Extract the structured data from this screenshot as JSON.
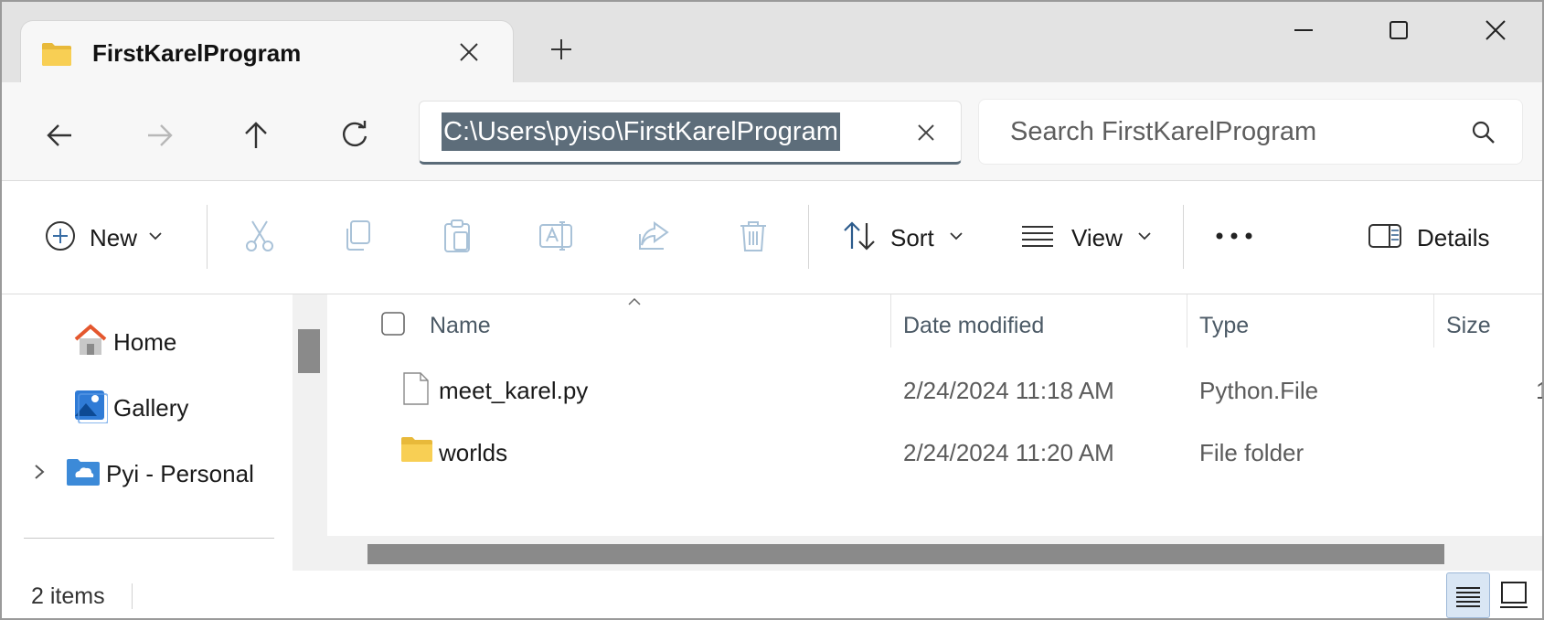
{
  "tab": {
    "title": "FirstKarelProgram"
  },
  "address": {
    "path": "C:\\Users\\pyiso\\FirstKarelProgram"
  },
  "search": {
    "placeholder": "Search FirstKarelProgram"
  },
  "toolbar": {
    "new_label": "New",
    "sort_label": "Sort",
    "view_label": "View",
    "details_label": "Details"
  },
  "sidebar": {
    "items": [
      {
        "label": "Home",
        "icon": "home-icon"
      },
      {
        "label": "Gallery",
        "icon": "gallery-icon"
      },
      {
        "label": "Pyi - Personal",
        "icon": "onedrive-folder-icon"
      }
    ]
  },
  "columns": {
    "name": "Name",
    "date": "Date modified",
    "type": "Type",
    "size": "Size"
  },
  "files": [
    {
      "name": "meet_karel.py",
      "date": "2/24/2024 11:18 AM",
      "type": "Python.File",
      "size": "1",
      "icon": "file-icon"
    },
    {
      "name": "worlds",
      "date": "2/24/2024 11:20 AM",
      "type": "File folder",
      "size": "",
      "icon": "folder-icon"
    }
  ],
  "status": {
    "items_count": "2 items"
  },
  "colors": {
    "address_highlight": "#5d6d7a",
    "folder_yellow": "#f4c542",
    "scroll_thumb": "#8a8a8a",
    "toggle_active": "#d9e6f4"
  }
}
